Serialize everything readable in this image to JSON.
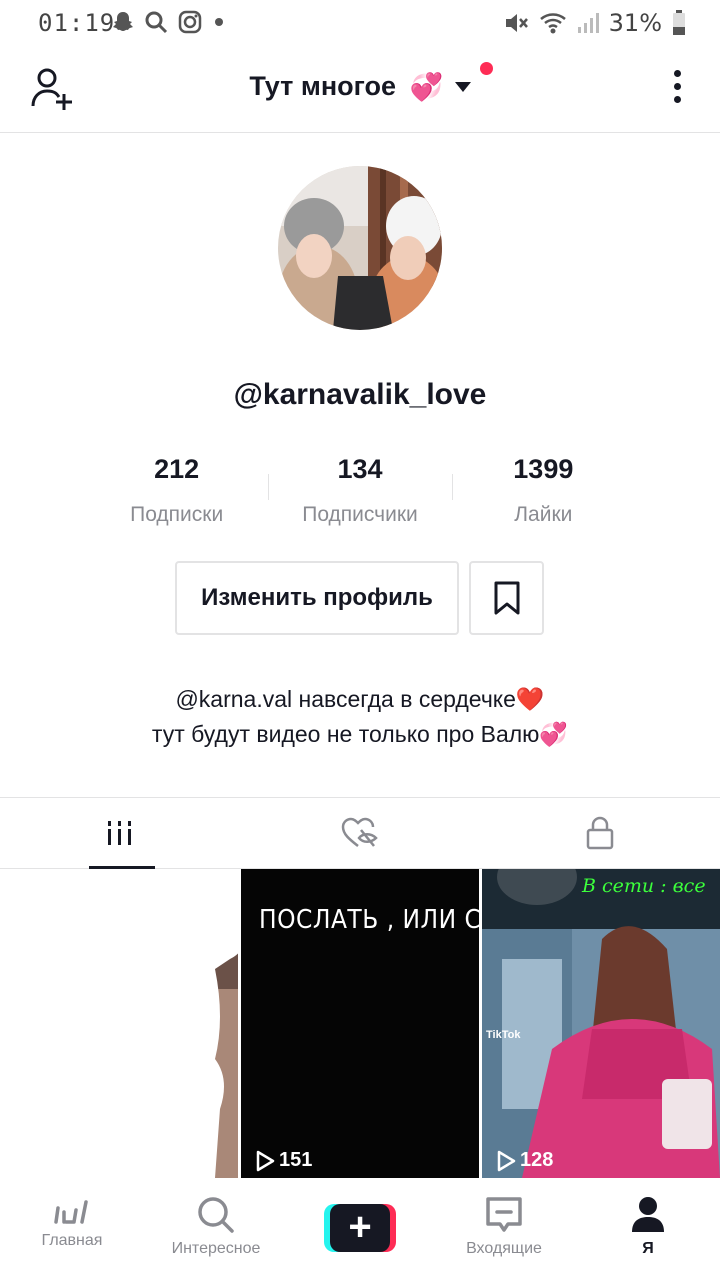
{
  "status_bar": {
    "time": "01:19",
    "battery": "31%",
    "left_icons": [
      "snapchat-icon",
      "search-icon",
      "instagram-icon",
      "dot-icon"
    ],
    "right_icons": [
      "mute-icon",
      "wifi-icon",
      "signal-icon",
      "battery-icon"
    ]
  },
  "header": {
    "title": "Тут многое",
    "title_emoji": "💞",
    "has_notification_dot": true,
    "accent_color": "#fe2c55"
  },
  "profile": {
    "username": "@karnavalik_love",
    "stats": [
      {
        "value": "212",
        "label": "Подписки"
      },
      {
        "value": "134",
        "label": "Подписчики"
      },
      {
        "value": "1399",
        "label": "Лайки"
      }
    ],
    "edit_button_label": "Изменить профиль",
    "bio_lines": [
      "@karna.val навсегда в сердечке❤️",
      "тут будут видео не только про Валю💞"
    ]
  },
  "tabs": [
    {
      "icon": "grid-icon",
      "active": true
    },
    {
      "icon": "liked-hidden-icon",
      "active": false
    },
    {
      "icon": "lock-icon",
      "active": false
    }
  ],
  "videos": [
    {
      "views": "",
      "overlay_text": ""
    },
    {
      "views": "151",
      "overlay_text": "ПОСЛАТЬ , ИЛИ САМА"
    },
    {
      "views": "128",
      "overlay_text": "В сети : все",
      "watermark": "TikTok"
    }
  ],
  "bottom_nav": [
    {
      "label": "Главная",
      "icon": "home-icon"
    },
    {
      "label": "Интересное",
      "icon": "discover-icon"
    },
    {
      "label": "",
      "icon": "create-plus-icon"
    },
    {
      "label": "Входящие",
      "icon": "inbox-icon"
    },
    {
      "label": "Я",
      "icon": "profile-icon",
      "active": true
    }
  ]
}
